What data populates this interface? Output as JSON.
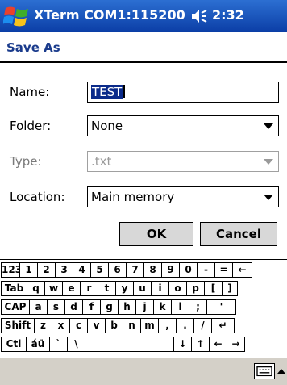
{
  "titlebar": {
    "title": "XTerm COM1:115200",
    "clock": "2:32"
  },
  "header": {
    "title": "Save As"
  },
  "form": {
    "name_label": "Name:",
    "name_value": "TEST",
    "folder_label": "Folder:",
    "folder_value": "None",
    "type_label": "Type:",
    "type_value": ".txt",
    "location_label": "Location:",
    "location_value": "Main memory"
  },
  "buttons": {
    "ok": "OK",
    "cancel": "Cancel"
  },
  "keyboard": {
    "rows": [
      [
        "123",
        "1",
        "2",
        "3",
        "4",
        "5",
        "6",
        "7",
        "8",
        "9",
        "0",
        "-",
        "=",
        "←"
      ],
      [
        "Tab",
        "q",
        "w",
        "e",
        "r",
        "t",
        "y",
        "u",
        "i",
        "o",
        "p",
        "[",
        "]"
      ],
      [
        "CAP",
        "a",
        "s",
        "d",
        "f",
        "g",
        "h",
        "j",
        "k",
        "l",
        ";",
        "'"
      ],
      [
        "Shift",
        "z",
        "x",
        "c",
        "v",
        "b",
        "n",
        "m",
        ",",
        ".",
        "/",
        "↵"
      ],
      [
        "Ctl",
        "áü",
        "`",
        "\\",
        "",
        "↓",
        "↑",
        "←",
        "→"
      ]
    ]
  },
  "icons": {
    "start": "windows-flag-icon",
    "speaker": "speaker-icon",
    "sip": "keyboard-icon"
  },
  "colors": {
    "titlebar": "#0b3ea6",
    "header_text": "#1a3b8c",
    "selection": "#0a2a8a"
  }
}
